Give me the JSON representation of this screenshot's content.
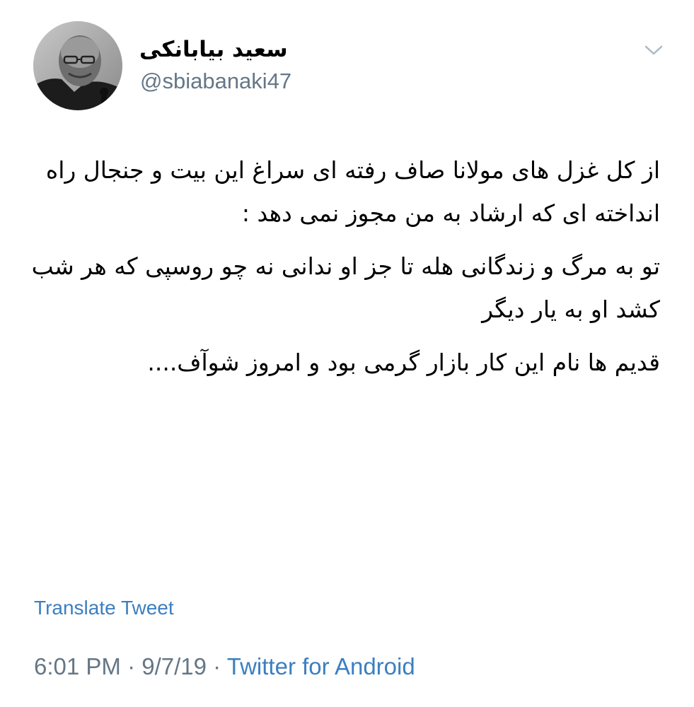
{
  "author": {
    "display_name": "سعید بیابانکی",
    "handle": "@sbiabanaki47",
    "avatar_icon": "profile-photo"
  },
  "menu_icon": "chevron-down-icon",
  "tweet": {
    "paragraphs": [
      "از کل غزل های مولانا صاف رفته ای سراغ این بیت و جنجال راه انداخته ای که ارشاد به من مجوز نمی دهد :",
      "تو به مرگ و زندگانی هله تا جز او ندانی نه چو روسپی که هر شب کشد او به یار دیگر",
      "قدیم ها نام این کار بازار گرمی بود و امروز شوآف...."
    ]
  },
  "translate_label": "Translate Tweet",
  "meta": {
    "time": "6:01 PM",
    "separator": "·",
    "date": "9/7/19",
    "source": "Twitter for Android"
  },
  "colors": {
    "link": "#3b7fc0",
    "secondary_text": "#657786",
    "primary_text": "#000000"
  }
}
